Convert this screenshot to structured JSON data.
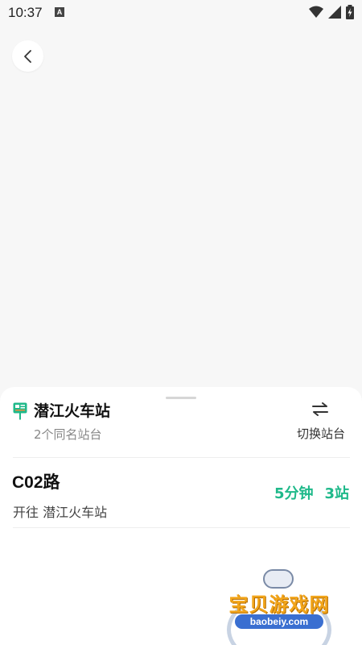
{
  "status_bar": {
    "time": "10:37",
    "notification_icon": "a-notification-icon",
    "wifi_icon": "wifi-icon",
    "signal_icon": "signal-icon",
    "battery_icon": "battery-charging-icon"
  },
  "nav": {
    "back_icon": "chevron-left-icon"
  },
  "station": {
    "name": "潜江火车站",
    "subtitle": "2个同名站台",
    "icon": "bus-stop-icon",
    "switch_label": "切换站台",
    "switch_icon": "swap-arrows-icon"
  },
  "routes": [
    {
      "name": "C02路",
      "direction": "开往 潜江火车站",
      "eta_minutes": "5分钟",
      "eta_stops": "3站"
    }
  ],
  "watermark": {
    "text": "宝贝游戏网",
    "url": "baobeiy.com"
  },
  "colors": {
    "accent": "#1fb98a",
    "background": "#f7f7f7",
    "sheet": "#ffffff"
  }
}
